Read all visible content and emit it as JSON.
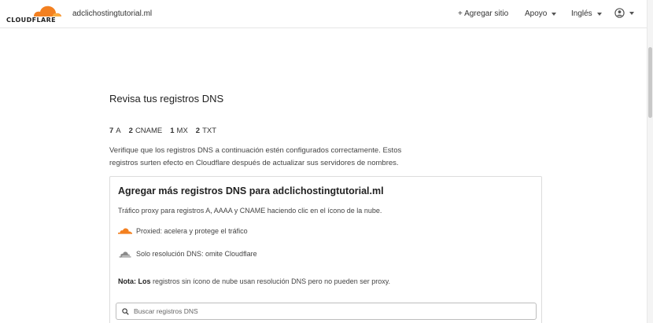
{
  "brand": {
    "logo_text": "CLOUDFLARE",
    "accent": "#f38020",
    "accent_light": "#faad3f"
  },
  "header": {
    "domain": "adclichostingtutorial.ml",
    "add_site": "+ Agregar sitio",
    "support": "Apoyo",
    "language": "Inglés",
    "user_icon": "user-circle-icon"
  },
  "main": {
    "title": "Revisa tus registros DNS",
    "counts": [
      {
        "num": "7",
        "type": "A"
      },
      {
        "num": "2",
        "type": "CNAME"
      },
      {
        "num": "1",
        "type": "MX"
      },
      {
        "num": "2",
        "type": "TXT"
      }
    ],
    "description": "Verifique que los registros DNS a continuación estén configurados correctamente. Estos registros surten efecto en Cloudflare después de actualizar sus servidores de nombres."
  },
  "card": {
    "title": "Agregar más registros DNS para adclichostingtutorial.ml",
    "subtitle": "Tráfico proxy para registros A, AAAA y CNAME haciendo clic en el ícono de la nube.",
    "proxied_label": "Proxied: acelera y protege el tráfico",
    "dns_only_label": "Solo resolución DNS: omite Cloudflare",
    "note_label": "Nota:",
    "note_bold": "Los",
    "note_text": "registros sin ícono de nube usan resolución DNS pero no pueden ser proxy.",
    "search_placeholder": "Buscar registros DNS"
  }
}
